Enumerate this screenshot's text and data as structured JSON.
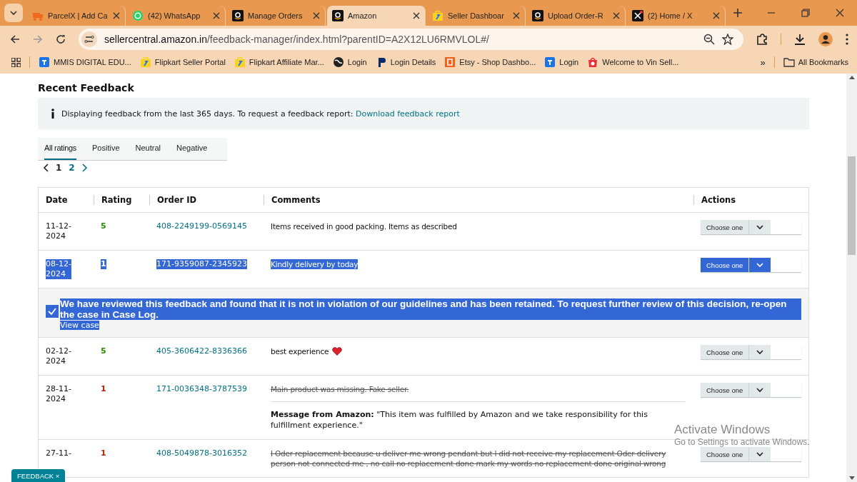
{
  "browser": {
    "tabs": [
      {
        "title": "ParcelX | Add Ca",
        "kind": "truck",
        "selected": false
      },
      {
        "title": "(42) WhatsApp",
        "kind": "chat",
        "selected": false
      },
      {
        "title": "Manage Orders",
        "kind": "store",
        "selected": false
      },
      {
        "title": "Amazon",
        "kind": "store",
        "selected": true
      },
      {
        "title": "Seller Dashboar",
        "kind": "bag",
        "selected": false
      },
      {
        "title": "Upload Order-R",
        "kind": "store",
        "selected": false
      },
      {
        "title": "(2) Home / X",
        "kind": "cross",
        "selected": false
      }
    ],
    "url_host": "sellercentral.amazon.in",
    "url_path": "/feedback-manager/index.html?parentID=A2X12LU6RMVLOL#/",
    "bookmarks": [
      {
        "title": "MMIS DIGITAL EDU...",
        "kind": "doc"
      },
      {
        "title": "Flipkart Seller Portal",
        "kind": "bag"
      },
      {
        "title": "Flipkart Affiliate Mar...",
        "kind": "bag"
      },
      {
        "title": "Login",
        "kind": "globe"
      },
      {
        "title": "Login Details",
        "kind": "pin"
      },
      {
        "title": "Etsy - Shop Dashbo...",
        "kind": "square"
      },
      {
        "title": "Login",
        "kind": "doc"
      },
      {
        "title": "Welcome to Vin Sell...",
        "kind": "tote"
      }
    ],
    "more": "»",
    "all_bookmarks": "All Bookmarks"
  },
  "heading": "Recent Feedback",
  "banner": {
    "text": "Displaying feedback from the last 365 days. To request a feedback report:",
    "link": "Download feedback report"
  },
  "filters": [
    {
      "label": "All ratings",
      "selected": true
    },
    {
      "label": "Positive",
      "selected": false
    },
    {
      "label": "Neutral",
      "selected": false
    },
    {
      "label": "Negative",
      "selected": false
    }
  ],
  "pages": [
    {
      "label": "1",
      "selected": true
    },
    {
      "label": "2",
      "selected": false
    }
  ],
  "table": {
    "columns": [
      "Date",
      "Rating",
      "Order ID",
      "Comments",
      "Actions"
    ],
    "rows": [
      {
        "kind": "plain",
        "date": "11-12-\n2024",
        "rating": "5",
        "color": "#2a8a00",
        "order": "408-2249199-0569145",
        "comment": "Items received in good packing. Items as described",
        "struck": false,
        "highlighted": false,
        "action": "Choose one"
      },
      {
        "kind": "plain",
        "date": "08-12-\n2024",
        "rating": "1",
        "order": "171-9359087-2345923",
        "comment": "Kindly delivery by today",
        "struck": false,
        "highlighted": true,
        "action": "Choose one",
        "notice": {
          "text": "We have reviewed this feedback and found that it is not in violation of our guidelines and has been retained. To request further review of this decision, re-open the case in Case Log.",
          "link": "View case"
        }
      },
      {
        "kind": "heart",
        "date": "02-12-\n2024",
        "rating": "5",
        "color": "#2a8a00",
        "order": "405-3606422-8336366",
        "comment": "best experience",
        "struck": false,
        "highlighted": false,
        "action": "Choose one"
      },
      {
        "kind": "plain",
        "date": "28-11-\n2024",
        "rating": "1",
        "color": "#b12704",
        "order": "171-0036348-3787539",
        "comment": "Main product was missing. Fake seller.",
        "struck": true,
        "highlighted": false,
        "action": "Choose one",
        "message": "**Message from Amazon:** \"This item was fulfilled by Amazon and we take responsibility for this fulfillment experience.\""
      },
      {
        "kind": "plain",
        "date": "27-11-",
        "rating": "1",
        "color": "#b12704",
        "order": "408-5049878-3016352",
        "comment": "I Oder replacement because u deliver me wrong pendant but I did not receive my replacement Oder delivery person not connected me , no call no replacement done mark my words no replacement done original wrong",
        "struck": true,
        "highlighted": false,
        "action": "Choose one"
      }
    ]
  },
  "feedback_tab": {
    "label": "FEEDBACK",
    "close": "×"
  },
  "os_notice": {
    "title": "Activate Windows",
    "text": "Go to Settings to activate Windows."
  }
}
